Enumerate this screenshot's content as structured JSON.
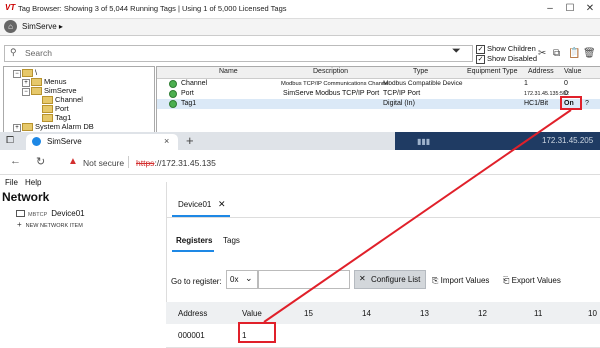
{
  "tag_browser": {
    "logo": "VT",
    "title": "Tag Browser: Showing 3 of 5,044 Running Tags | Using 1 of 5,000 Licensed Tags",
    "breadcrumb": "SimServe",
    "search_placeholder": "Search",
    "show_children": "Show Children",
    "show_disabled": "Show Disabled",
    "tree": [
      {
        "label": "\\"
      },
      {
        "label": "Menus"
      },
      {
        "label": "SimServe"
      },
      {
        "label": "Channel"
      },
      {
        "label": "Port"
      },
      {
        "label": "Tag1"
      },
      {
        "label": "System Alarm DB"
      }
    ],
    "columns": [
      "Name",
      "Description",
      "Type",
      "Equipment Type",
      "Address",
      "Value"
    ],
    "rows": [
      {
        "name": "Channel",
        "description": "Modbus TCP/IP Communications Channel",
        "type": "Modbus Compatible Device",
        "equipment": "",
        "address": "1",
        "value": "0"
      },
      {
        "name": "Port",
        "description": "SimServe Modbus TCP/IP Port",
        "type": "TCP/IP Port",
        "equipment": "",
        "address": "172.31.45.135:502",
        "value": "0"
      },
      {
        "name": "Tag1",
        "description": "",
        "type": "Digital (In)",
        "equipment": "",
        "address": "HC1/Bit",
        "value": "On",
        "extra": "?"
      }
    ]
  },
  "browser": {
    "tab_title": "SimServe",
    "tab_close": "×",
    "new_tab": "+",
    "remote_ip": "172.31.45.205",
    "not_secure": "Not secure",
    "url_scheme": "https",
    "url_rest": "://172.31.45.135"
  },
  "app": {
    "menu": [
      "File",
      "Help"
    ],
    "sidebar_title": "Network",
    "device_prefix": "MBTCP",
    "device_name": "Device01",
    "new_network": "NEW NETWORK ITEM",
    "device_tab": "Device01",
    "sub_tabs": [
      "Registers",
      "Tags"
    ],
    "goto_label": "Go to register:",
    "goto_select": "0x",
    "configure_label": "Configure List",
    "import_label": "Import Values",
    "export_label": "Export Values",
    "table_headers": [
      "Address",
      "Value",
      "15",
      "14",
      "13",
      "12",
      "11",
      "10"
    ],
    "table_rows": [
      {
        "address": "000001",
        "value": "1"
      }
    ]
  }
}
